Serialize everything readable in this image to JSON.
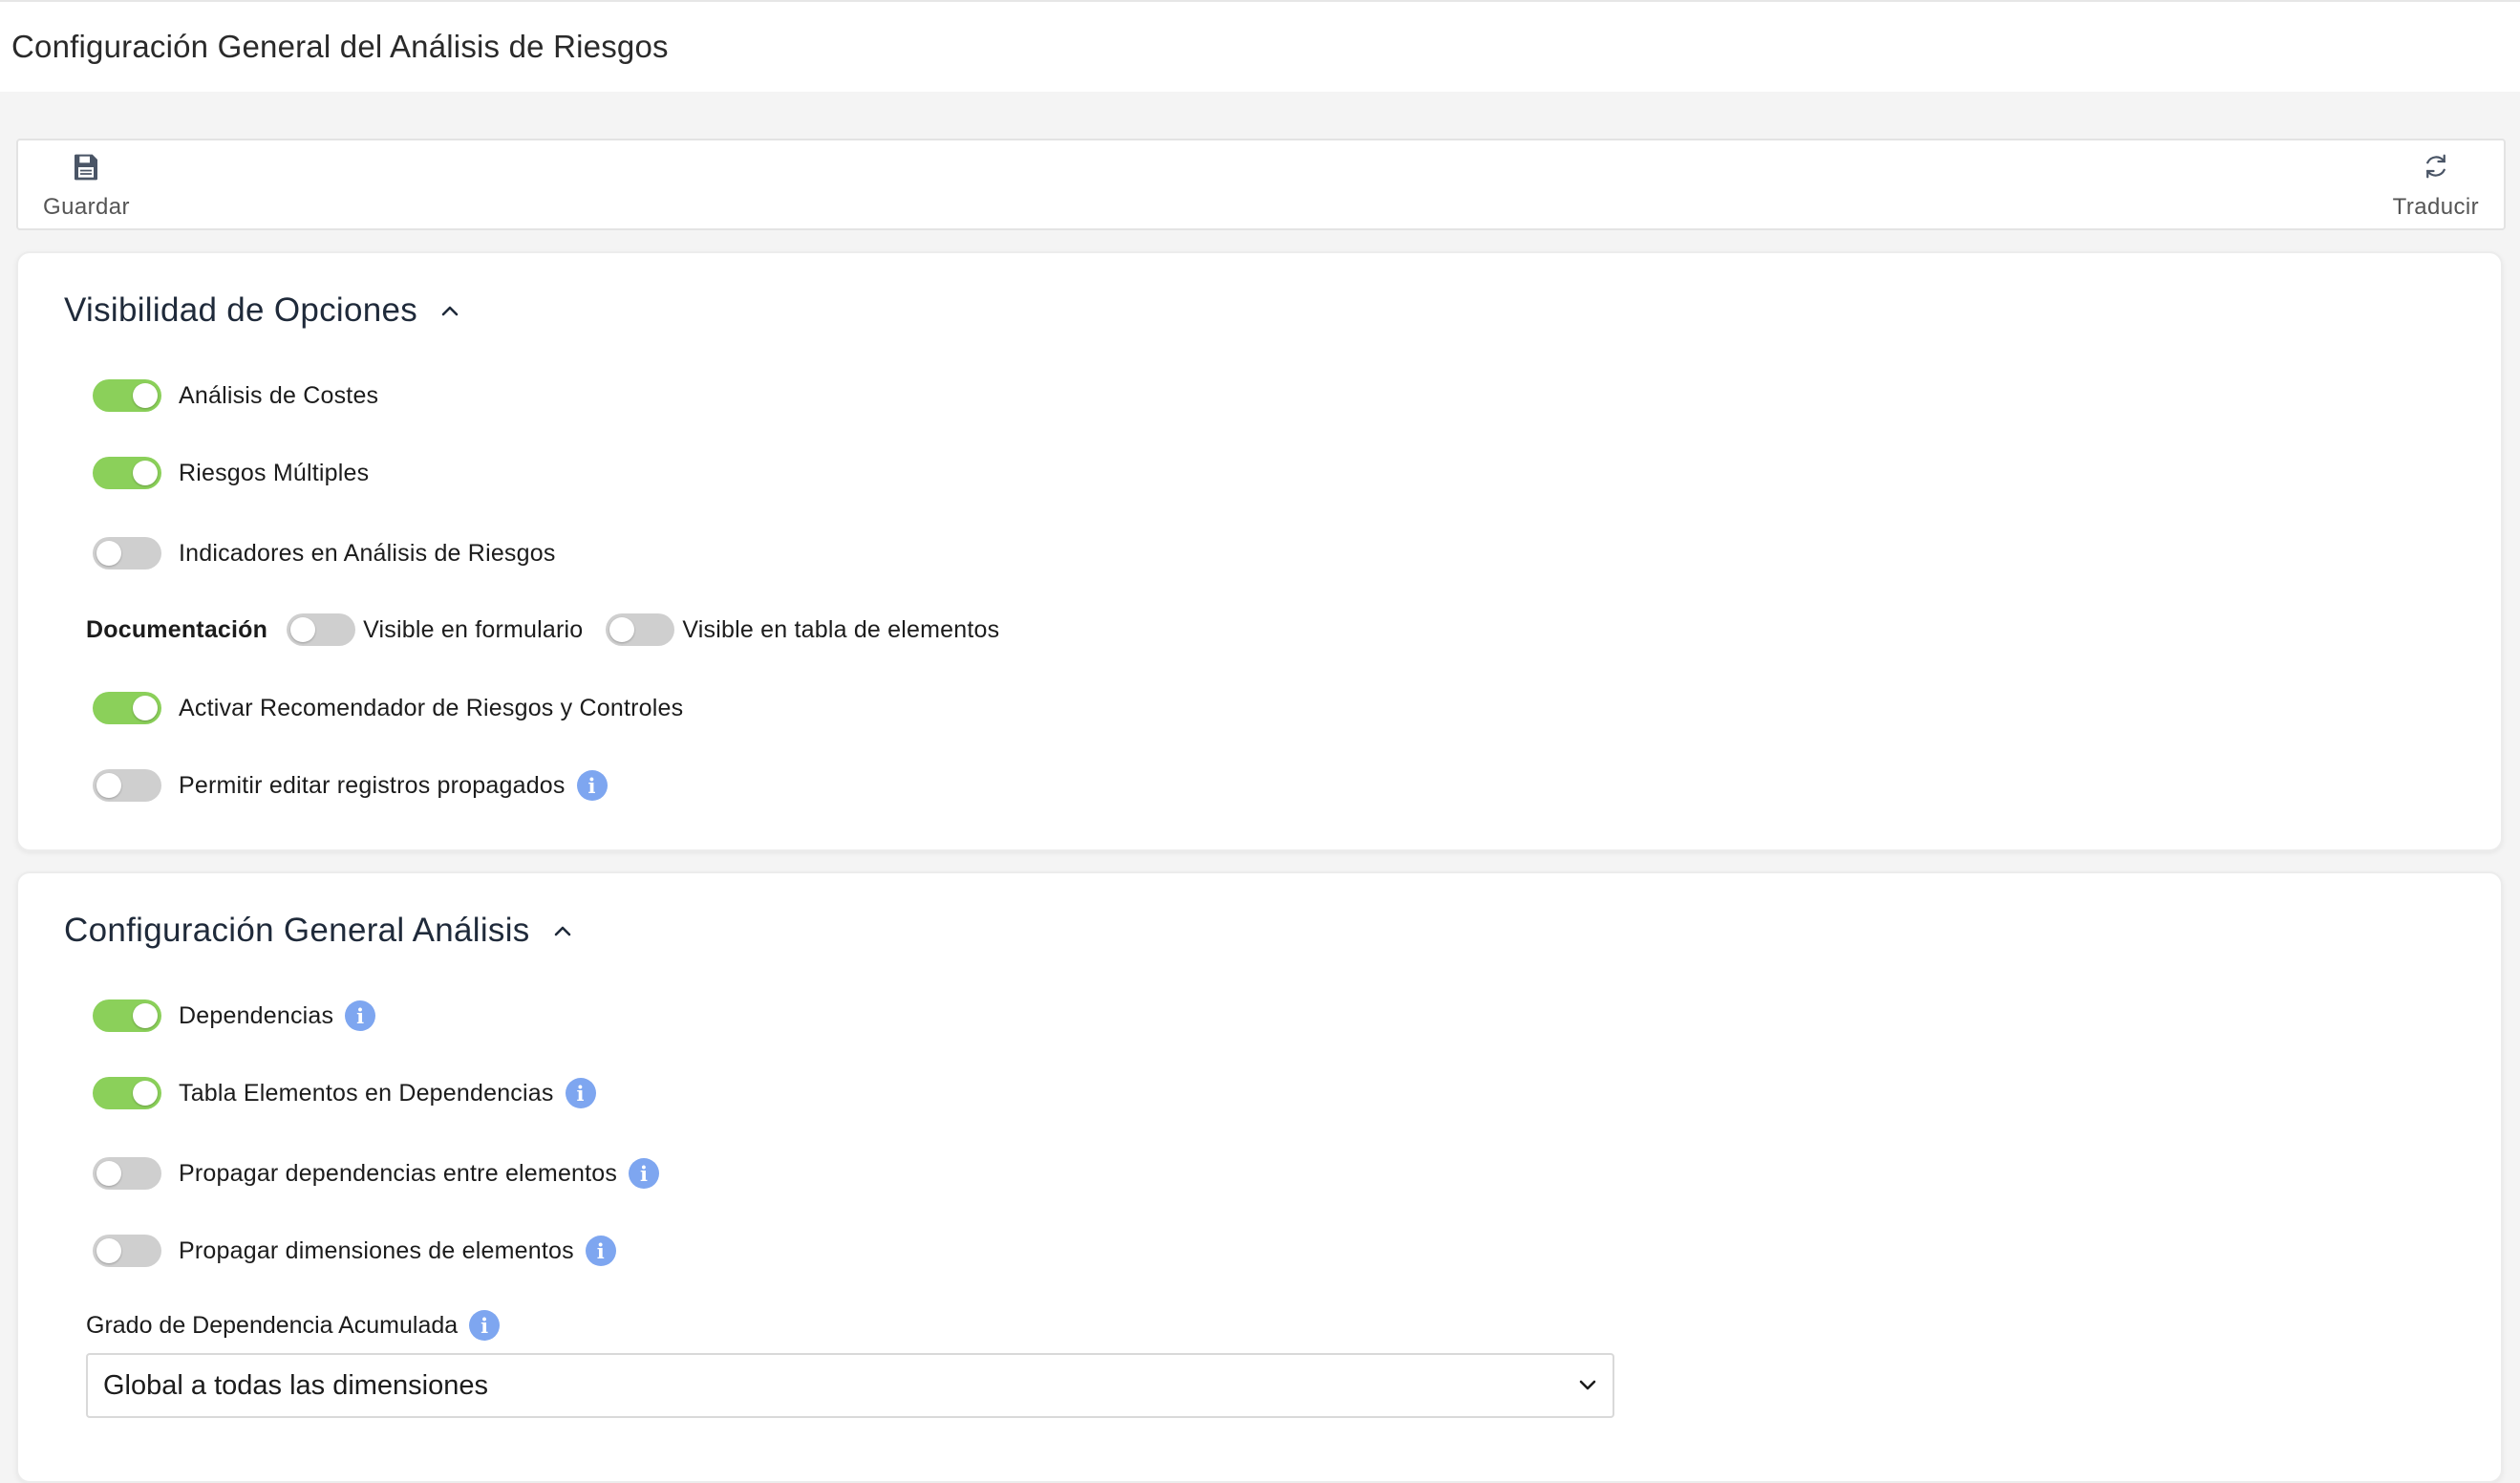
{
  "page": {
    "title": "Configuración General del Análisis de Riesgos"
  },
  "toolbar": {
    "save_label": "Guardar",
    "translate_label": "Traducir"
  },
  "visibility": {
    "title": "Visibilidad de Opciones",
    "items": [
      {
        "label": "Análisis de Costes",
        "on": true
      },
      {
        "label": "Riesgos Múltiples",
        "on": true
      },
      {
        "label": "Indicadores en Análisis de Riesgos",
        "on": false
      }
    ],
    "documentation": {
      "label": "Documentación",
      "form_label": "Visible en formulario",
      "form_on": false,
      "table_label": "Visible en tabla de elementos",
      "table_on": false
    },
    "items2": [
      {
        "label": "Activar Recomendador de Riesgos y Controles",
        "on": true
      },
      {
        "label": "Permitir editar registros propagados",
        "on": false
      }
    ]
  },
  "general": {
    "title": "Configuración General Análisis",
    "items": [
      {
        "label": "Dependencias",
        "on": true
      },
      {
        "label": "Tabla Elementos en Dependencias",
        "on": true
      },
      {
        "label": "Propagar dependencias entre elementos",
        "on": false
      },
      {
        "label": "Propagar dimensiones de elementos",
        "on": false
      }
    ],
    "degree_label": "Grado de Dependencia Acumulada",
    "degree_value": "Global a todas las dimensiones"
  },
  "icons": {
    "save": "save-icon",
    "translate": "refresh-icon",
    "collapse": "chevron-up-icon",
    "info": "info-icon",
    "dropdown": "chevron-down-icon",
    "info_glyph": "i"
  },
  "colors": {
    "toggle_on": "#8bd05a",
    "toggle_off": "#cfcfcf",
    "info": "#7ea6f0"
  }
}
